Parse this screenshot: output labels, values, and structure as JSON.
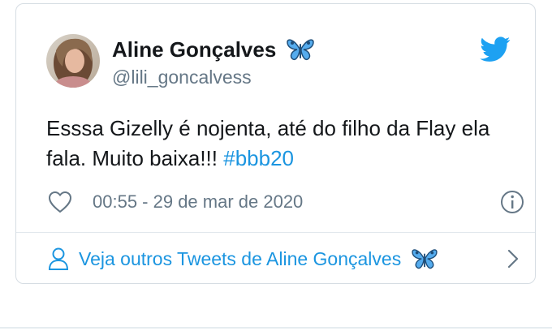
{
  "tweet": {
    "display_name": "Aline Gonçalves",
    "handle": "@lili_goncalvess",
    "text_part1": "Esssa Gizelly é nojenta, até do filho da Flay ela fala. Muito baixa!!! ",
    "hashtag": "#bbb20",
    "timestamp": "00:55 - 29 de mar de 2020",
    "footer_link": "Veja outros Tweets de Aline Gonçalves"
  },
  "icons": {
    "verified_emoji": "butterfly-icon",
    "logo": "twitter-bird-icon",
    "like": "heart-icon",
    "info": "info-icon",
    "profile": "person-icon",
    "chevron": "chevron-right-icon"
  },
  "colors": {
    "link": "#1b95e0",
    "text": "#14171a",
    "muted": "#657786",
    "border": "#d6dde3",
    "twitter_blue": "#1da1f2"
  }
}
